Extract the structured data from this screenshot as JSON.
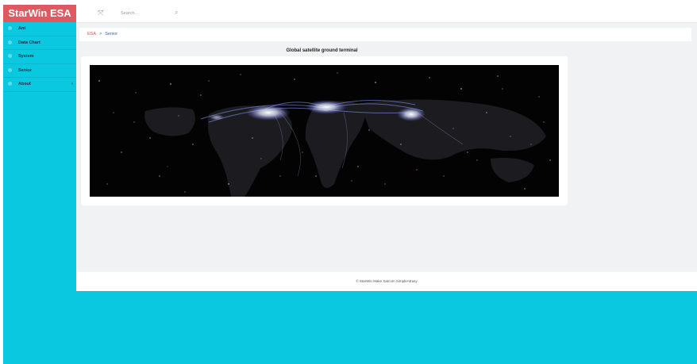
{
  "app": {
    "brand": "StarWin ESA"
  },
  "sidebar": {
    "items": [
      {
        "label": "Ant"
      },
      {
        "label": "Data Chart"
      },
      {
        "label": "System"
      },
      {
        "label": "Senior"
      },
      {
        "label": "About",
        "chevron": "‹"
      }
    ]
  },
  "topbar": {
    "menu_toggle_icon": "⤧",
    "search_placeholder": "Search...",
    "search_icon": "⌕"
  },
  "breadcrumb": {
    "root": "ESA",
    "separator": ">",
    "current": "Senior"
  },
  "card": {
    "title": "Global satellite ground terminal"
  },
  "footer": {
    "text": "© StarWin Make Satcom SimpleAEasy"
  },
  "colors": {
    "sidebar_bg": "#0ac8e0",
    "brand_bg": "#e05860",
    "breadcrumb_root": "#d9534f",
    "breadcrumb_current": "#3a5fcd"
  }
}
